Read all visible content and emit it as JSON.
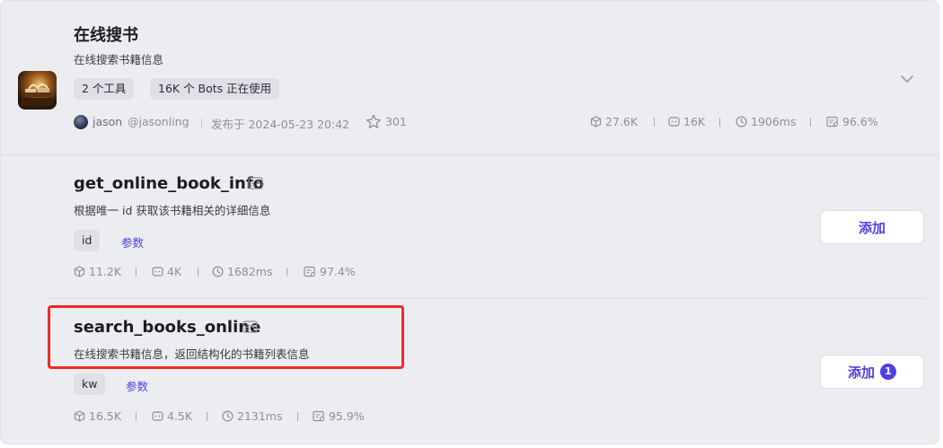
{
  "plugin": {
    "title": "在线搜书",
    "description": "在线搜索书籍信息",
    "tags": [
      "2 个工具",
      "16K 个 Bots 正在使用"
    ],
    "author_name": "jason",
    "author_handle": "@jasonling",
    "published": "发布于 2024-05-23 20:42",
    "stars": "301",
    "stats": {
      "calls": "27.6K",
      "bots": "16K",
      "latency": "1906ms",
      "success": "96.6%"
    }
  },
  "tools": [
    {
      "name": "get_online_book_info",
      "description": "根据唯一 id 获取该书籍相关的详细信息",
      "param": "id",
      "params_label": "参数",
      "stats": {
        "calls": "11.2K",
        "bots": "4K",
        "latency": "1682ms",
        "success": "97.4%"
      },
      "add_label": "添加",
      "add_count": null
    },
    {
      "name": "search_books_online",
      "description": "在线搜索书籍信息，返回结构化的书籍列表信息",
      "param": "kw",
      "params_label": "参数",
      "stats": {
        "calls": "16.5K",
        "bots": "4.5K",
        "latency": "2131ms",
        "success": "95.9%"
      },
      "add_label": "添加",
      "add_count": "1"
    }
  ],
  "colors": {
    "accent": "#4e40e5",
    "highlight": "#ee2b24"
  }
}
